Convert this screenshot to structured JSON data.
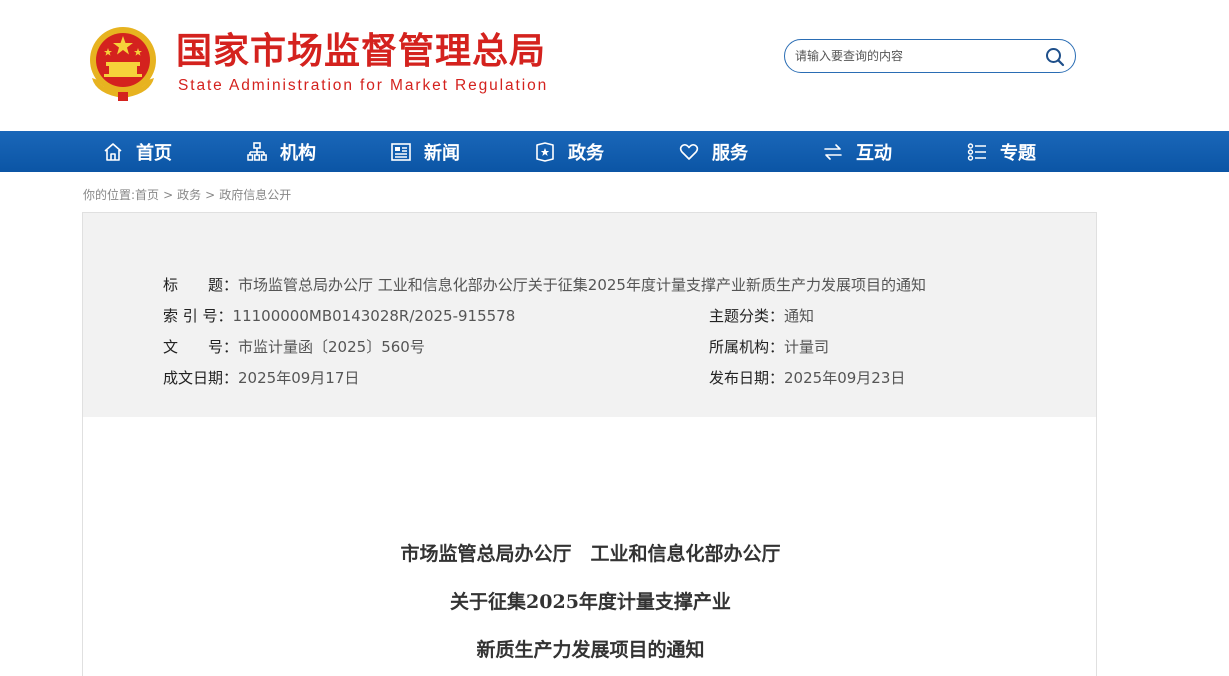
{
  "header": {
    "title_cn": "国家市场监督管理总局",
    "title_en": "State Administration for Market Regulation",
    "emblem_icon": "national-emblem-icon",
    "brand_color": "#d4221e"
  },
  "search": {
    "placeholder": "请输入要查询的内容",
    "icon": "search-icon"
  },
  "nav": {
    "items": [
      {
        "label": "首页",
        "icon": "home-icon"
      },
      {
        "label": "机构",
        "icon": "org-chart-icon"
      },
      {
        "label": "新闻",
        "icon": "newspaper-icon"
      },
      {
        "label": "政务",
        "icon": "document-icon"
      },
      {
        "label": "服务",
        "icon": "heart-icon"
      },
      {
        "label": "互动",
        "icon": "exchange-arrows-icon"
      },
      {
        "label": "专题",
        "icon": "list-icon"
      }
    ],
    "color": "#0f5aa9"
  },
  "breadcrumb": {
    "prefix": "你的位置:",
    "items": [
      "首页",
      "政务",
      "政府信息公开"
    ],
    "separator": ">"
  },
  "info": {
    "title_label": "标　　题：",
    "title_value": "市场监管总局办公厅 工业和信息化部办公厅关于征集2025年度计量支撑产业新质生产力发展项目的通知",
    "index_label": "索 引 号：",
    "index_value": "11100000MB0143028R/2025-915578",
    "topic_label": "主题分类：",
    "topic_value": "通知",
    "docno_label": "文　　号：",
    "docno_value": "市监计量函〔2025〕560号",
    "org_label": "所属机构：",
    "org_value": "计量司",
    "made_label": "成文日期：",
    "made_value": "2025年09月17日",
    "pub_label": "发布日期：",
    "pub_value": "2025年09月23日"
  },
  "document": {
    "title_line1": "市场监管总局办公厅　工业和信息化部办公厅",
    "title_line2": "关于征集2025年度计量支撑产业",
    "title_line3": "新质生产力发展项目的通知"
  }
}
